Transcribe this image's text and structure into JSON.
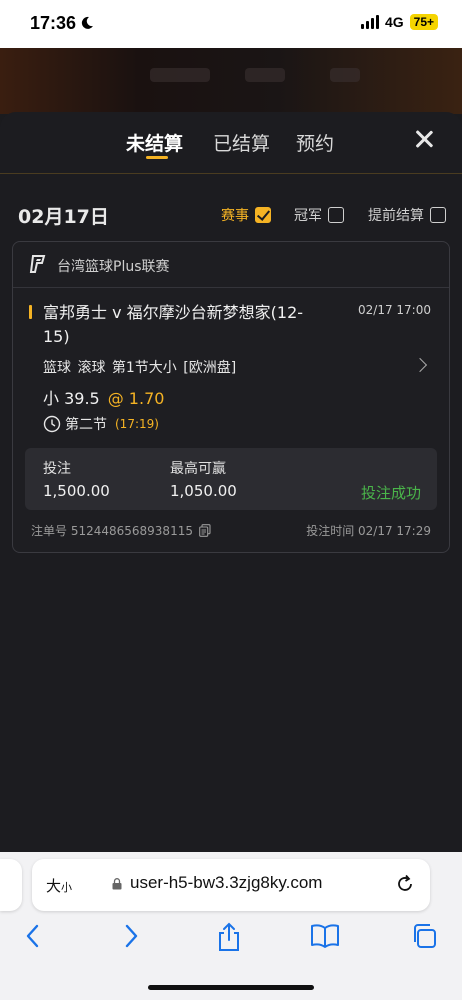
{
  "status_bar": {
    "time": "17:36",
    "network": "4G",
    "battery": "75+"
  },
  "tabs": [
    {
      "label": "未结算",
      "active": true
    },
    {
      "label": "已结算",
      "active": false
    },
    {
      "label": "预约",
      "active": false
    }
  ],
  "date": "02月17日",
  "filters": [
    {
      "label": "赛事",
      "checked": true
    },
    {
      "label": "冠军",
      "checked": false
    },
    {
      "label": "提前结算",
      "checked": false
    }
  ],
  "bet": {
    "league": "台湾篮球Plus联赛",
    "match_line1": "富邦勇士 v 福尔摩沙台新梦想家(12-",
    "match_line2": "15)",
    "match_time": "02/17 17:00",
    "market": "篮球  滚球   第1节大小  [欧洲盘]",
    "selection": "小 39.5",
    "odds": "@ 1.70",
    "period": "第二节",
    "period_clock": "(17:19)",
    "stake_label": "投注",
    "stake_value": "1,500.00",
    "max_win_label": "最高可赢",
    "max_win_value": "1,050.00",
    "status": "投注成功",
    "ticket": "注单号 5124486568938115",
    "bet_time": "投注时间 02/17 17:29"
  },
  "browser": {
    "text_size": "大",
    "text_size_small": "小",
    "url": "user-h5-bw3.3zjg8ky.com"
  },
  "colors": {
    "accent": "#f5b324",
    "success": "#4ab54a",
    "background": "#1c1c20"
  }
}
